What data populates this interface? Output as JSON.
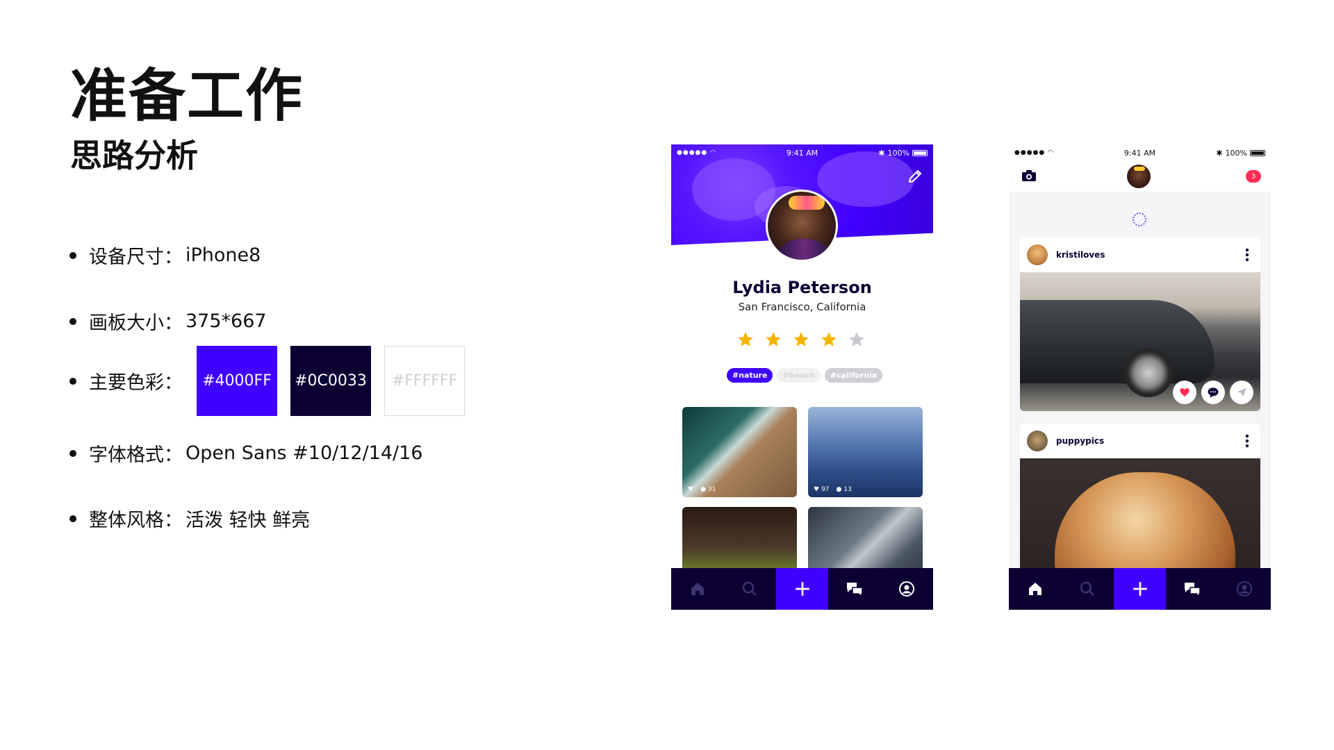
{
  "slide": {
    "title": "准备工作",
    "subtitle": "思路分析"
  },
  "specs": [
    {
      "label": "设备尺寸：",
      "value": "iPhone8"
    },
    {
      "label": "画板大小：",
      "value": "375*667"
    },
    {
      "label": "主要色彩：",
      "value": ""
    },
    {
      "label": "字体格式：",
      "value": "Open Sans #10/12/14/16"
    },
    {
      "label": "整体风格：",
      "value": "活泼 轻快 鲜亮"
    }
  ],
  "colors": [
    {
      "hex": "#4000FF",
      "label": "#4000FF"
    },
    {
      "hex": "#0C0033",
      "label": "#0C0033"
    },
    {
      "hex": "#FFFFFF",
      "label": "#FFFFFF"
    }
  ],
  "profile_screen": {
    "status": {
      "time": "9:41 AM",
      "battery": "100%"
    },
    "name": "Lydia Peterson",
    "location": "San Francisco, California",
    "rating": 4,
    "rating_max": 5,
    "tags": [
      "#nature",
      "#beach",
      "#california"
    ],
    "tiles": [
      {
        "comments": "31"
      },
      {
        "likes": "97",
        "comments": "13"
      }
    ]
  },
  "feed_screen": {
    "status": {
      "time": "9:41 AM",
      "battery": "100%"
    },
    "notification_count": "3",
    "posts": [
      {
        "user": "kristiloves"
      },
      {
        "user": "puppypics"
      }
    ]
  },
  "tabbar": [
    "home-icon",
    "search-icon",
    "plus-icon",
    "chat-icon",
    "profile-icon"
  ],
  "icons": [
    "signal-dots-icon",
    "wifi-icon",
    "bluetooth-icon",
    "battery-icon",
    "pencil-icon",
    "star-icon",
    "heart-icon",
    "comment-icon",
    "camera-icon",
    "send-icon",
    "more-icon",
    "spinner-icon"
  ]
}
